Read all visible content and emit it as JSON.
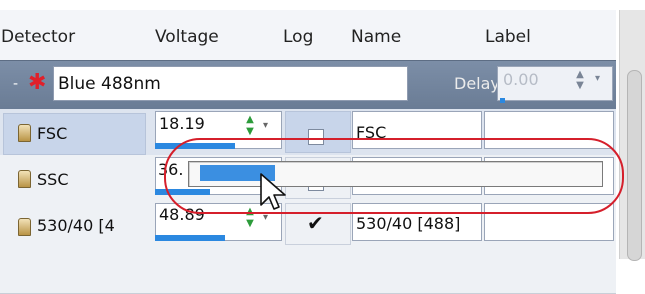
{
  "header": {
    "detector": "Detector",
    "voltage": "Voltage",
    "log": "Log",
    "name": "Name",
    "label": "Label"
  },
  "laser": {
    "collapse": "-",
    "star_icon": "laser-star-icon",
    "name": "Blue 488nm",
    "delay_label": "Delay:",
    "delay_value": "0.00"
  },
  "rows": [
    {
      "detector": "FSC",
      "voltage": "18.19",
      "log": false,
      "name": "FSC",
      "label": ""
    },
    {
      "detector": "SSC",
      "voltage": "36.",
      "log": false,
      "name": "",
      "label": ""
    },
    {
      "detector": "530/40 [4",
      "voltage": "48.89",
      "log": true,
      "name": "530/40 [488]",
      "label": ""
    }
  ],
  "popup": {
    "fill_fraction": 0.19
  },
  "colors": {
    "accent": "#2b88e0",
    "annotation": "#d51f2b",
    "laser_bar": "#6f8199"
  }
}
